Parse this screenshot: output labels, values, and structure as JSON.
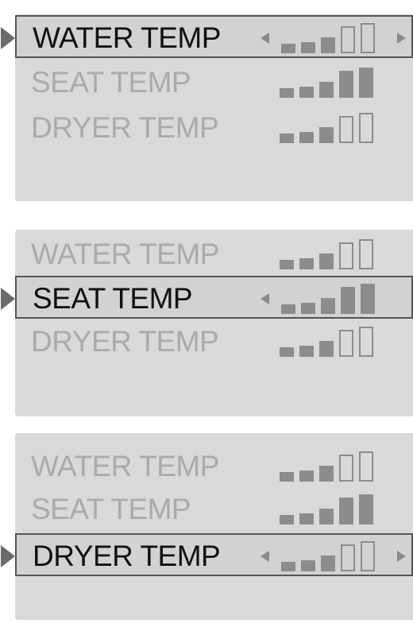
{
  "colors": {
    "panel": "#d9d9d9",
    "inactive_text": "#aaaaaa",
    "active_text": "#111111",
    "bar": "#8c8c8c",
    "pointer": "#6b6b6b"
  },
  "screens": [
    {
      "selected": 0,
      "rows": [
        {
          "label": "WATER TEMP",
          "level": 3,
          "max": 5
        },
        {
          "label": "SEAT TEMP",
          "level": 5,
          "max": 5
        },
        {
          "label": "DRYER TEMP",
          "level": 3,
          "max": 5
        }
      ]
    },
    {
      "selected": 1,
      "rows": [
        {
          "label": "WATER TEMP",
          "level": 3,
          "max": 5
        },
        {
          "label": "SEAT TEMP",
          "level": 5,
          "max": 5
        },
        {
          "label": "DRYER TEMP",
          "level": 3,
          "max": 5
        }
      ]
    },
    {
      "selected": 2,
      "rows": [
        {
          "label": "WATER TEMP",
          "level": 3,
          "max": 5
        },
        {
          "label": "SEAT TEMP",
          "level": 5,
          "max": 5
        },
        {
          "label": "DRYER TEMP",
          "level": 3,
          "max": 5
        }
      ]
    }
  ]
}
